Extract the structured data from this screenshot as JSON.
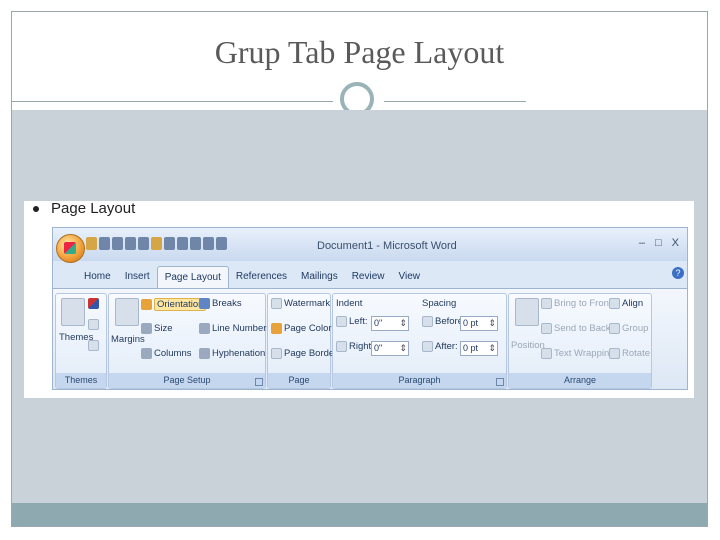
{
  "slide": {
    "title": "Grup Tab Page Layout",
    "bullet": "Page Layout"
  },
  "window": {
    "title": "Document1 - Microsoft Word",
    "controls": [
      "–",
      "□",
      "X"
    ]
  },
  "tabs": [
    "Home",
    "Insert",
    "Page Layout",
    "References",
    "Mailings",
    "Review",
    "View"
  ],
  "active_tab": "Page Layout",
  "groups": {
    "themes": {
      "label": "Themes",
      "button": "Themes"
    },
    "page_setup": {
      "label": "Page Setup",
      "margins": "Margins",
      "orientation": "Orientation",
      "size": "Size",
      "columns": "Columns",
      "breaks": "Breaks",
      "line_numbers": "Line Numbers",
      "hyphenation": "Hyphenation"
    },
    "page_background": {
      "label": "Page Background",
      "watermark": "Watermark",
      "page_color": "Page Color",
      "page_borders": "Page Borders"
    },
    "paragraph": {
      "label": "Paragraph",
      "indent": "Indent",
      "left_label": "Left:",
      "left_value": "0\"",
      "right_label": "Right:",
      "right_value": "0\"",
      "spacing": "Spacing",
      "before_label": "Before:",
      "before_value": "0 pt",
      "after_label": "After:",
      "after_value": "0 pt"
    },
    "arrange": {
      "label": "Arrange",
      "position": "Position",
      "bring_to_front": "Bring to Front",
      "send_to_back": "Send to Back",
      "text_wrapping": "Text Wrapping",
      "align": "Align",
      "group": "Group",
      "rotate": "Rotate"
    }
  },
  "colors": {
    "slide_band": "#c8d2d8",
    "footer_bar": "#8eaab0",
    "ribbon_label": "#c5d7ee"
  }
}
